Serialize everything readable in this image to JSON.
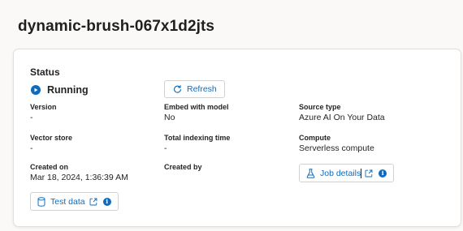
{
  "page": {
    "title": "dynamic-brush-067x1d2jts"
  },
  "status": {
    "label": "Status",
    "value": "Running",
    "refresh_label": "Refresh"
  },
  "fields": {
    "version": {
      "label": "Version",
      "value": "-"
    },
    "embed_model": {
      "label": "Embed with model",
      "value": "No"
    },
    "source_type": {
      "label": "Source type",
      "value": "Azure AI On Your Data"
    },
    "vector_store": {
      "label": "Vector store",
      "value": "-"
    },
    "total_indexing_time": {
      "label": "Total indexing time",
      "value": "-"
    },
    "compute": {
      "label": "Compute",
      "value": "Serverless compute"
    },
    "created_on": {
      "label": "Created on",
      "value": "Mar 18, 2024, 1:36:39 AM"
    },
    "created_by": {
      "label": "Created by",
      "value": ""
    }
  },
  "actions": {
    "job_details_label": "Job details",
    "test_data_label": "Test data"
  },
  "icons": {
    "status": "running-status-icon",
    "refresh": "refresh-icon",
    "job": "flask-icon",
    "test": "database-icon",
    "external": "open-external-icon",
    "info": "info-icon"
  },
  "colors": {
    "accent": "#0f6cbd",
    "border": "#d1d1d1",
    "text": "#242424"
  }
}
